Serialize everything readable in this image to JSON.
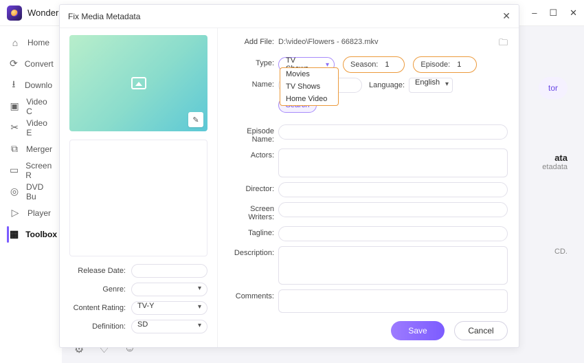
{
  "app": {
    "title": "Wonder"
  },
  "window_controls": {
    "min": "–",
    "max": "☐",
    "close": "✕"
  },
  "sidebar": {
    "items": [
      {
        "icon": "⌂",
        "label": "Home"
      },
      {
        "icon": "⟳",
        "label": "Convert"
      },
      {
        "icon": "⭳",
        "label": "Downlo"
      },
      {
        "icon": "▣",
        "label": "Video C"
      },
      {
        "icon": "✂",
        "label": "Video E"
      },
      {
        "icon": "⧉",
        "label": "Merger"
      },
      {
        "icon": "▭",
        "label": "Screen R"
      },
      {
        "icon": "◎",
        "label": "DVD Bu"
      },
      {
        "icon": "▷",
        "label": "Player"
      },
      {
        "icon": "▦",
        "label": "Toolbox"
      }
    ]
  },
  "bottom": {
    "gear": "⚙",
    "bell": "♡",
    "user": "☺"
  },
  "bg": {
    "chip_suffix": "tor",
    "card_title": "ata",
    "card_sub": "etadata",
    "note_suffix": "CD."
  },
  "modal": {
    "title": "Fix Media Metadata",
    "close": "✕",
    "left": {
      "edit_icon": "✎",
      "release_date": "Release Date:",
      "genre": "Genre:",
      "content_rating": "Content Rating:",
      "definition": "Definition:",
      "content_rating_val": "TV-Y",
      "definition_val": "SD"
    },
    "right": {
      "add_file": "Add File:",
      "file_path": "D:\\video\\Flowers - 66823.mkv",
      "folder_icon": "🗀",
      "type_label": "Type:",
      "type_value": "TV Shows",
      "type_options": [
        "Movies",
        "TV Shows",
        "Home Video"
      ],
      "season_label": "Season:",
      "season_value": "1",
      "episode_label": "Episode:",
      "episode_value": "1",
      "name_label": "Name:",
      "language_label": "Language:",
      "language_value": "English",
      "search": "Search",
      "episode_name": "Episode Name:",
      "actors": "Actors:",
      "director": "Director:",
      "screen_writers": "Screen Writers:",
      "tagline": "Tagline:",
      "description": "Description:",
      "comments": "Comments:"
    },
    "footer": {
      "save": "Save",
      "cancel": "Cancel"
    }
  }
}
